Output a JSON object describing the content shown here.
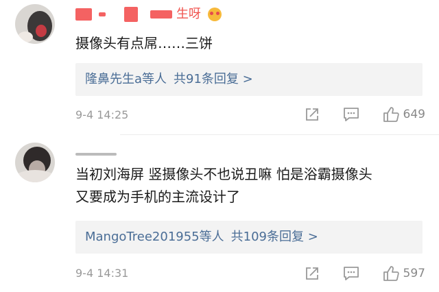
{
  "comments": [
    {
      "username_suffix": "生呀",
      "text": "摄像头有点屌……三饼",
      "replies_users": "隆鼻先生a等人",
      "replies_count": "共91条回复 >",
      "time": "9-4 14:25",
      "likes": "649"
    },
    {
      "username_suffix": "",
      "text": "当初刘海屏 竖摄像头不也说丑嘛 怕是浴霸摄像头\n又要成为手机的主流设计了",
      "replies_users": "MangoTree201955等人",
      "replies_count": "共109条回复 >",
      "time": "9-4 14:31",
      "likes": "597"
    }
  ],
  "icons": {
    "share": "share-icon",
    "comment": "comment-icon",
    "like": "thumbs-up-icon"
  },
  "colors": {
    "username": "#f0544f",
    "reply_link": "#4a6d96",
    "meta": "#999999"
  }
}
